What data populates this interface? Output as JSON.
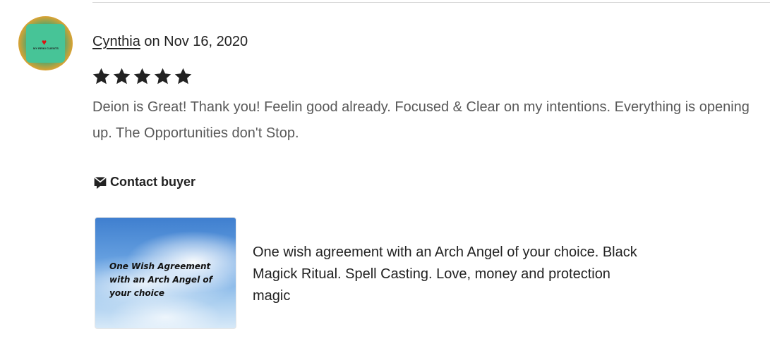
{
  "review": {
    "reviewer_name": "Cynthia",
    "date_text": " on Nov 16, 2020",
    "rating": 5,
    "rating_max": 5,
    "text": "Deion is Great! Thank you! Feelin good already. Focused & Clear on my intentions. Everything is opening up. The Opportunities don't Stop.",
    "avatar": {
      "caption": "MY REIKI CLIENTS",
      "icon": "heart-icon"
    }
  },
  "contact": {
    "label": "Contact buyer",
    "icon": "message-icon"
  },
  "listing": {
    "image_caption": "One Wish Agreement with an Arch Angel of your choice",
    "title": "One wish agreement with an Arch Angel of your choice. Black Magick Ritual. Spell Casting. Love, money and protection magic"
  },
  "colors": {
    "text_primary": "#222222",
    "text_secondary": "#595959",
    "star": "#222222",
    "divider": "#d9d9d9"
  }
}
